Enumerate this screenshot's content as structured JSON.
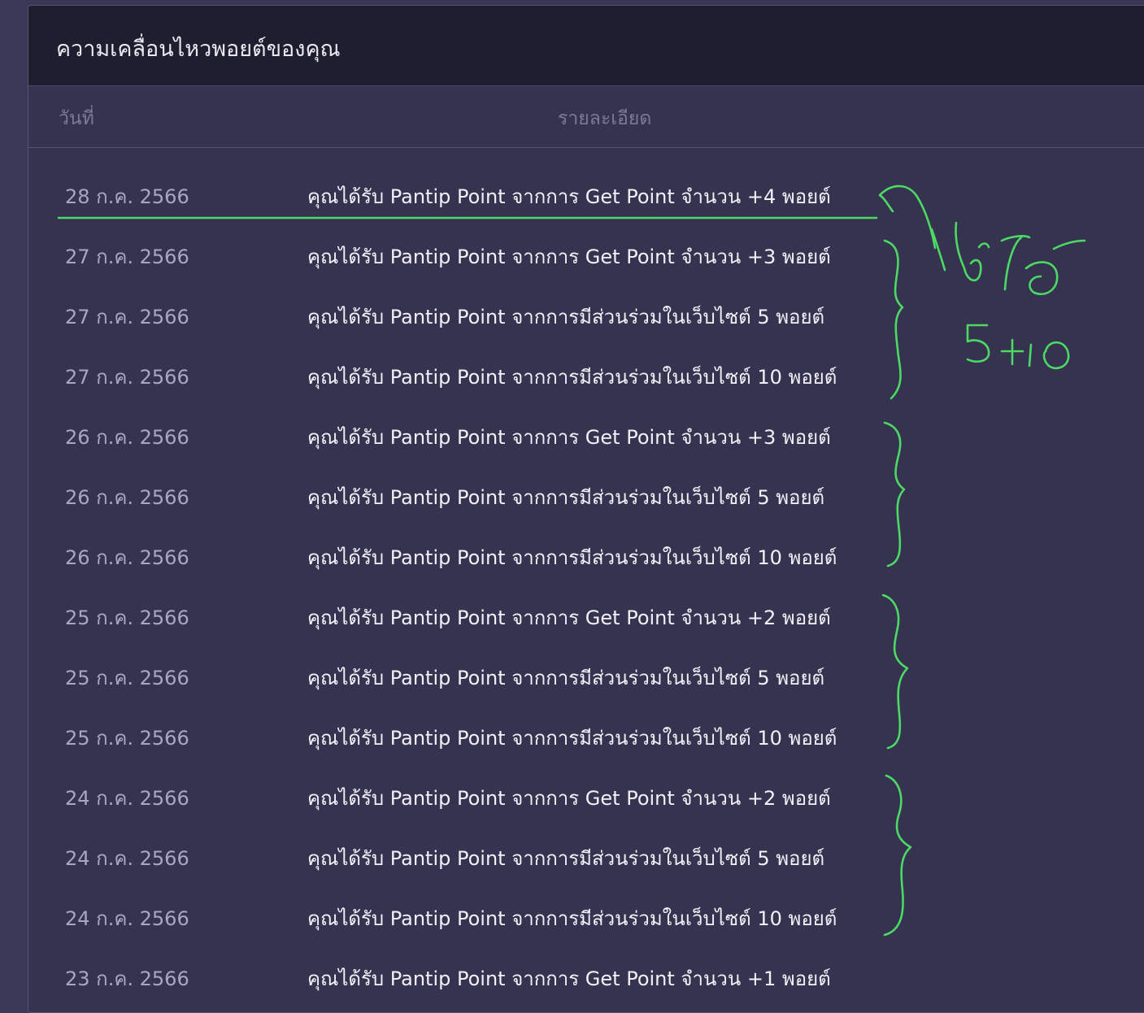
{
  "panel": {
    "title": "ความเคลื่อนไหวพอยต์ของคุณ",
    "columns": {
      "date": "วันที่",
      "detail": "รายละเอียด"
    }
  },
  "rows": [
    {
      "date": "28 ก.ค. 2566",
      "detail": "คุณได้รับ Pantip Point จากการ Get Point จำนวน +4 พอยต์"
    },
    {
      "date": "27 ก.ค. 2566",
      "detail": "คุณได้รับ Pantip Point จากการ Get Point จำนวน +3 พอยต์"
    },
    {
      "date": "27 ก.ค. 2566",
      "detail": "คุณได้รับ Pantip Point จากการมีส่วนร่วมในเว็บไซต์ 5 พอยต์"
    },
    {
      "date": "27 ก.ค. 2566",
      "detail": "คุณได้รับ Pantip Point จากการมีส่วนร่วมในเว็บไซต์ 10 พอยต์"
    },
    {
      "date": "26 ก.ค. 2566",
      "detail": "คุณได้รับ Pantip Point จากการ Get Point จำนวน +3 พอยต์"
    },
    {
      "date": "26 ก.ค. 2566",
      "detail": "คุณได้รับ Pantip Point จากการมีส่วนร่วมในเว็บไซต์ 5 พอยต์"
    },
    {
      "date": "26 ก.ค. 2566",
      "detail": "คุณได้รับ Pantip Point จากการมีส่วนร่วมในเว็บไซต์ 10 พอยต์"
    },
    {
      "date": "25 ก.ค. 2566",
      "detail": "คุณได้รับ Pantip Point จากการ Get Point จำนวน +2 พอยต์"
    },
    {
      "date": "25 ก.ค. 2566",
      "detail": "คุณได้รับ Pantip Point จากการมีส่วนร่วมในเว็บไซต์ 5 พอยต์"
    },
    {
      "date": "25 ก.ค. 2566",
      "detail": "คุณได้รับ Pantip Point จากการมีส่วนร่วมในเว็บไซต์ 10 พอยต์"
    },
    {
      "date": "24 ก.ค. 2566",
      "detail": "คุณได้รับ Pantip Point จากการ Get Point จำนวน +2 พอยต์"
    },
    {
      "date": "24 ก.ค. 2566",
      "detail": "คุณได้รับ Pantip Point จากการมีส่วนร่วมในเว็บไซต์ 5 พอยต์"
    },
    {
      "date": "24 ก.ค. 2566",
      "detail": "คุณได้รับ Pantip Point จากการมีส่วนร่วมในเว็บไซต์ 10 พอยต์"
    },
    {
      "date": "23 ก.ค. 2566",
      "detail": "คุณได้รับ Pantip Point จากการ Get Point จำนวน +1 พอยต์"
    }
  ],
  "annotation": {
    "color": "#4cd964",
    "note_line1": "ไม่ได้",
    "note_line2": "5+10"
  }
}
